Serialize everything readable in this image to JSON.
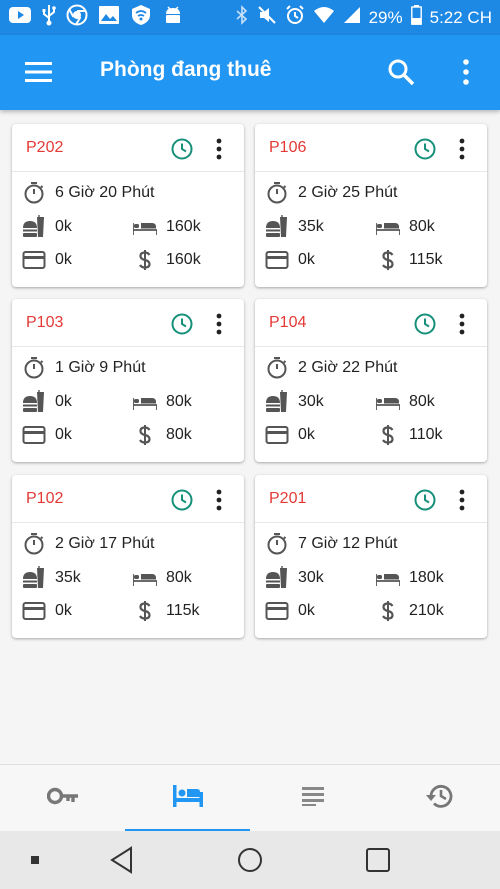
{
  "status_bar": {
    "battery": "29%",
    "time": "5:22 CH",
    "left_icons": [
      "youtube-icon",
      "usb-icon",
      "chrome-icon",
      "gallery-icon",
      "vpn-shield-icon",
      "android-debug-icon"
    ],
    "right_icons": [
      "bluetooth-icon",
      "mute-icon",
      "alarm-icon",
      "wifi-icon",
      "signal-icon",
      "battery-icon"
    ]
  },
  "app_bar": {
    "title": "Phòng đang thuê",
    "icons": [
      "menu-icon",
      "search-icon",
      "more-vert-icon"
    ]
  },
  "colors": {
    "primary": "#2196f3",
    "status_bar": "#1e88e5",
    "room_name": "#e53935",
    "clock_icon": "#16907a",
    "icon_gray": "#555555"
  },
  "rooms": [
    {
      "name": "P202",
      "duration": "6 Giờ 20 Phút",
      "food": "0k",
      "room_charge": "160k",
      "paid": "0k",
      "total": "160k"
    },
    {
      "name": "P106",
      "duration": "2 Giờ 25 Phút",
      "food": "35k",
      "room_charge": "80k",
      "paid": "0k",
      "total": "115k"
    },
    {
      "name": "P103",
      "duration": "1 Giờ 9 Phút",
      "food": "0k",
      "room_charge": "80k",
      "paid": "0k",
      "total": "80k"
    },
    {
      "name": "P104",
      "duration": "2 Giờ 22 Phút",
      "food": "30k",
      "room_charge": "80k",
      "paid": "0k",
      "total": "110k"
    },
    {
      "name": "P102",
      "duration": "2 Giờ 17 Phút",
      "food": "35k",
      "room_charge": "80k",
      "paid": "0k",
      "total": "115k"
    },
    {
      "name": "P201",
      "duration": "7 Giờ 12 Phút",
      "food": "30k",
      "room_charge": "180k",
      "paid": "0k",
      "total": "210k"
    }
  ],
  "bottom_nav": {
    "tabs": [
      "key-icon",
      "bed-icon",
      "list-icon",
      "history-icon"
    ],
    "active_tab": "bed-icon"
  },
  "system_nav": [
    "recent-dot-icon",
    "back-icon",
    "home-icon",
    "overview-icon"
  ]
}
